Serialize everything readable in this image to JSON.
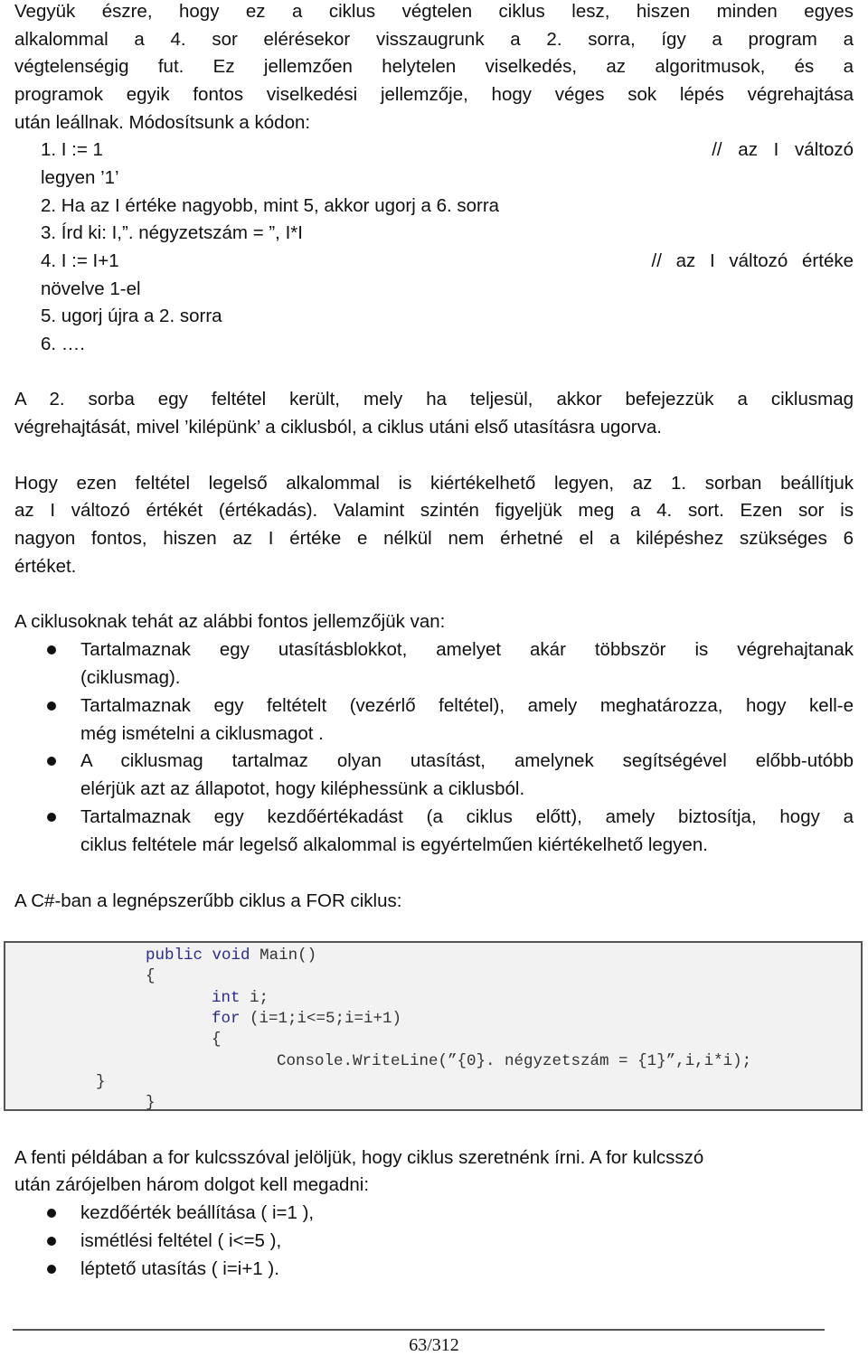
{
  "paragraph1": [
    "Vegyük észre, hogy ez a ciklus végtelen ciklus lesz, hiszen minden egyes",
    "alkalommal a 4. sor elérésekor visszaugrunk a 2. sorra, így a program a",
    "végtelenségig fut. Ez jellemzően helytelen viselkedés, az algoritmusok, és a",
    "programok egyik fontos viselkedési jellemzője, hogy véges sok lépés végrehajtása",
    "után leállnak. Módosítsunk a kódon:"
  ],
  "algorithm": {
    "l1_code": "1. I := 1",
    "l1_comment": "// az I változó",
    "l1_cont": "legyen ’1’",
    "l2": "2. Ha az I értéke nagyobb, mint 5, akkor ugorj a 6. sorra",
    "l3": "3. Írd ki: I,”. négyzetszám = ”, I*I",
    "l4_code": "4. I := I+1",
    "l4_comment": "// az I változó értéke",
    "l4_cont": "növelve 1-el",
    "l5": "5. ugorj újra a 2. sorra",
    "l6": "6. …."
  },
  "paragraph2": [
    "A 2. sorba egy feltétel került, mely ha teljesül, akkor befejezzük a ciklusmag",
    "végrehajtását, mivel ’kilépünk’ a ciklusból, a ciklus utáni első utasításra ugorva."
  ],
  "paragraph3": [
    "Hogy ezen feltétel legelső alkalommal is kiértékelhető legyen, az 1. sorban beállítjuk",
    "az I változó értékét (értékadás). Valamint szintén figyeljük meg a 4. sort. Ezen sor is",
    "nagyon fontos, hiszen az I értéke e nélkül nem érhetné el a kilépéshez szükséges 6",
    "értéket."
  ],
  "list_intro": "A ciklusoknak tehát az alábbi fontos jellemzőjük van:",
  "list_items": [
    [
      "Tartalmaznak egy utasításblokkot, amelyet akár többször is végrehajtanak",
      "(ciklusmag)."
    ],
    [
      "Tartalmaznak egy feltételt (vezérlő feltétel), amely meghatározza, hogy kell-e",
      "még ismételni a ciklusmagot ."
    ],
    [
      "A ciklusmag tartalmaz olyan utasítást, amelynek segítségével előbb-utóbb",
      "elérjük azt az állapotot, hogy kiléphessünk a ciklusból."
    ],
    [
      "Tartalmaznak egy kezdőértékadást (a ciklus előtt), amely biztosítja, hogy a",
      "ciklus feltétele már legelső alkalommal is egyértelműen kiértékelhető legyen."
    ]
  ],
  "for_intro": "A C#-ban a legnépszerűbb ciklus a FOR ciklus:",
  "code": {
    "kw_public": "public",
    "kw_void": "void",
    "main_sig": "Main()",
    "open1": "{",
    "kw_int": "int",
    "int_rest": "i;",
    "kw_for": "for",
    "for_rest": "(i=1;i<=5;i=i+1)",
    "open2": "{",
    "writeline": "Console.WriteLine(”{0}. négyzetszám = {1}”,i,i*i);",
    "close_inner": "}",
    "close_outer": "}"
  },
  "paragraph4": [
    "A fenti példában a for kulcsszóval jelöljük, hogy ciklus szeretnénk írni. A for kulcsszó",
    "után zárójelben három dolgot kell megadni:"
  ],
  "for_parts": [
    "kezdőérték beállítása ( i=1 ),",
    "ismétlési feltétel ( i<=5 ),",
    "léptető utasítás ( i=i+1 )."
  ],
  "footer": {
    "page_number": "63/312"
  }
}
